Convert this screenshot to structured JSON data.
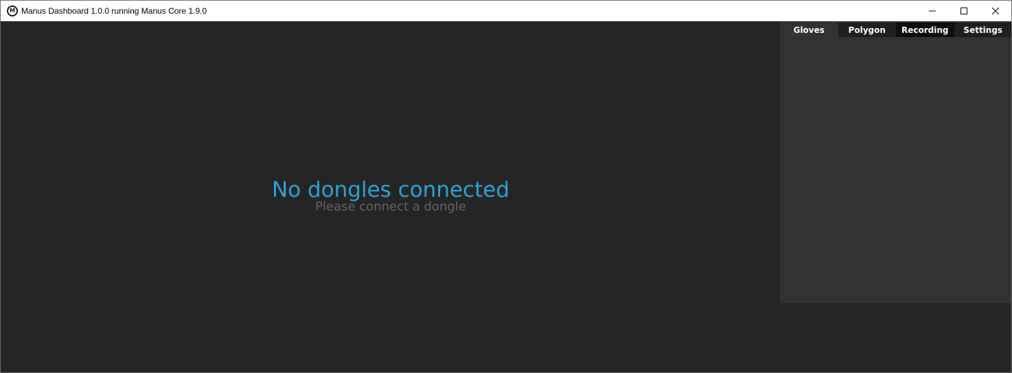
{
  "window": {
    "title": "Manus Dashboard 1.0.0 running Manus Core 1.9.0",
    "icon": "manus-logo-icon",
    "icon_letter": "M"
  },
  "controls": {
    "minimize": "minimize-icon",
    "maximize": "maximize-icon",
    "close": "close-icon"
  },
  "tabs": [
    {
      "label": "Gloves",
      "active": false
    },
    {
      "label": "Polygon",
      "active": false
    },
    {
      "label": "Recording",
      "active": true
    },
    {
      "label": "Settings",
      "active": false
    }
  ],
  "message": {
    "title": "No dongles connected",
    "subtitle": "Please connect a dongle"
  },
  "colors": {
    "accent": "#2aa3d9",
    "background": "#252525",
    "panel": "#323232",
    "subtitle": "#666666"
  }
}
